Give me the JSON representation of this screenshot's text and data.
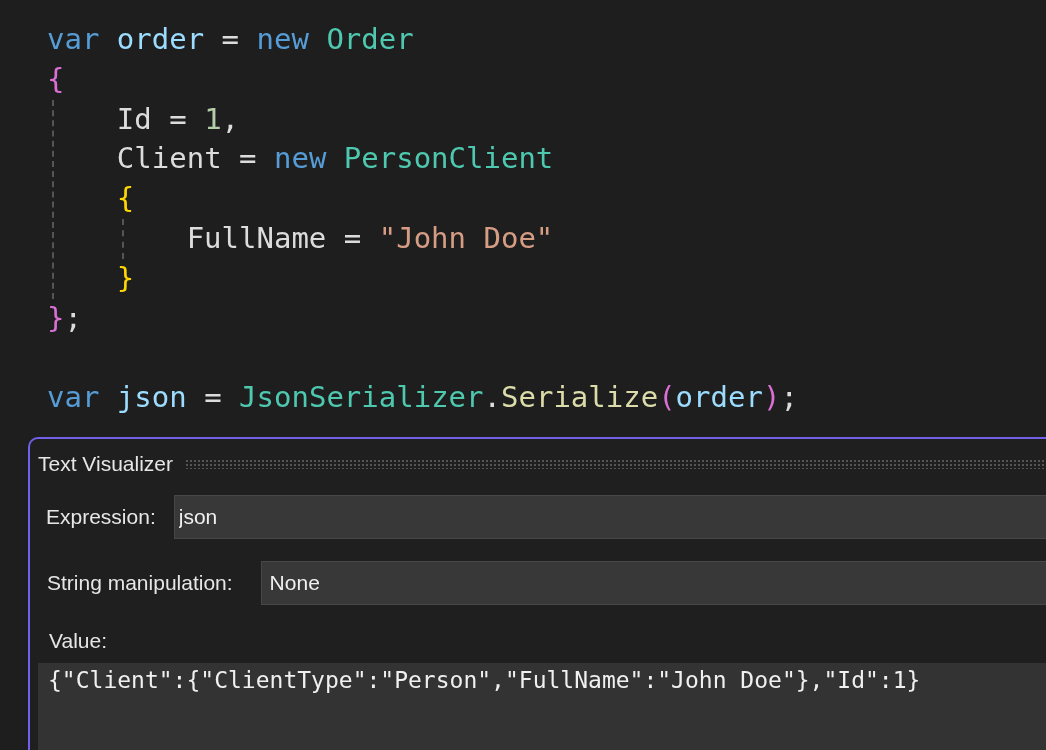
{
  "code_blocks": [
    {
      "lines": [
        {
          "tokens": [
            {
              "kind": "keyword",
              "text": "var",
              "spaced": false
            },
            {
              "kind": "variable",
              "text": "order",
              "spaced": true
            },
            {
              "kind": "plain",
              "text": "=",
              "spaced": true
            },
            {
              "kind": "keyword",
              "text": "new",
              "spaced": true
            },
            {
              "kind": "type",
              "text": "Order",
              "spaced": true
            }
          ]
        },
        {
          "tokens": [
            {
              "kind": "brace1",
              "text": "{",
              "spaced": false
            }
          ],
          "children": [
            {
              "tokens": [
                {
                  "kind": "plain",
                  "text": "Id",
                  "spaced": false
                },
                {
                  "kind": "plain",
                  "text": "=",
                  "spaced": true
                },
                {
                  "kind": "number",
                  "text": "1",
                  "spaced": true
                },
                {
                  "kind": "plain",
                  "text": ",",
                  "spaced": false
                }
              ]
            },
            {
              "tokens": [
                {
                  "kind": "plain",
                  "text": "Client",
                  "spaced": false
                },
                {
                  "kind": "plain",
                  "text": "=",
                  "spaced": true
                },
                {
                  "kind": "keyword",
                  "text": "new",
                  "spaced": true
                },
                {
                  "kind": "type",
                  "text": "PersonClient",
                  "spaced": true
                }
              ]
            },
            {
              "tokens": [
                {
                  "kind": "brace2",
                  "text": "{",
                  "spaced": false
                }
              ],
              "children": [
                {
                  "tokens": [
                    {
                      "kind": "plain",
                      "text": "FullName",
                      "spaced": false
                    },
                    {
                      "kind": "plain",
                      "text": "=",
                      "spaced": true
                    },
                    {
                      "kind": "string",
                      "text": "\"John Doe\"",
                      "spaced": true
                    }
                  ]
                }
              ]
            },
            {
              "tokens": [
                {
                  "kind": "brace2",
                  "text": "}",
                  "spaced": false
                }
              ]
            }
          ]
        },
        {
          "tokens": [
            {
              "kind": "brace1",
              "text": "}",
              "spaced": false
            },
            {
              "kind": "plain",
              "text": ";",
              "spaced": false
            }
          ]
        }
      ]
    },
    {
      "lines": [
        {
          "tokens": [
            {
              "kind": "keyword",
              "text": "var",
              "spaced": false
            },
            {
              "kind": "variable",
              "text": "json",
              "spaced": true
            },
            {
              "kind": "plain",
              "text": "=",
              "spaced": true
            },
            {
              "kind": "type",
              "text": "JsonSerializer",
              "spaced": true
            },
            {
              "kind": "plain",
              "text": ".",
              "spaced": false
            },
            {
              "kind": "method",
              "text": "Serialize",
              "spaced": false
            },
            {
              "kind": "brace3",
              "text": "(",
              "spaced": false
            },
            {
              "kind": "variable",
              "text": "order",
              "spaced": false
            },
            {
              "kind": "brace3",
              "text": ")",
              "spaced": false
            },
            {
              "kind": "plain",
              "text": ";",
              "spaced": false
            }
          ]
        }
      ]
    }
  ],
  "dialog": {
    "title": "Text Visualizer",
    "expression": {
      "label": "Expression:",
      "value": "json"
    },
    "string_manipulation": {
      "label": "String manipulation:",
      "value": "None"
    },
    "value": {
      "label": "Value:",
      "text": "{\"Client\":{\"ClientType\":\"Person\",\"FullName\":\"John Doe\"},\"Id\":1}"
    }
  }
}
